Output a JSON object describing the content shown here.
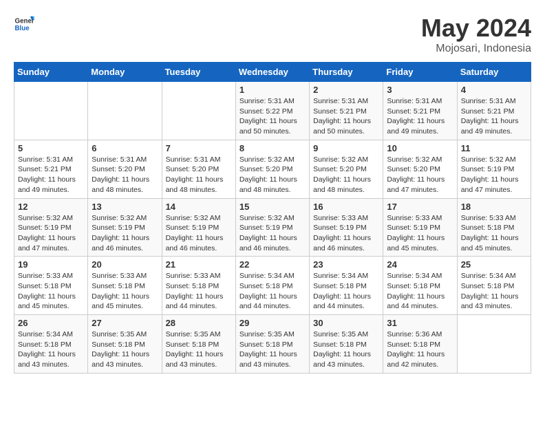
{
  "header": {
    "logo_general": "General",
    "logo_blue": "Blue",
    "month": "May 2024",
    "location": "Mojosari, Indonesia"
  },
  "weekdays": [
    "Sunday",
    "Monday",
    "Tuesday",
    "Wednesday",
    "Thursday",
    "Friday",
    "Saturday"
  ],
  "weeks": [
    [
      {
        "day": "",
        "sunrise": "",
        "sunset": "",
        "daylight": ""
      },
      {
        "day": "",
        "sunrise": "",
        "sunset": "",
        "daylight": ""
      },
      {
        "day": "",
        "sunrise": "",
        "sunset": "",
        "daylight": ""
      },
      {
        "day": "1",
        "sunrise": "Sunrise: 5:31 AM",
        "sunset": "Sunset: 5:22 PM",
        "daylight": "Daylight: 11 hours and 50 minutes."
      },
      {
        "day": "2",
        "sunrise": "Sunrise: 5:31 AM",
        "sunset": "Sunset: 5:21 PM",
        "daylight": "Daylight: 11 hours and 50 minutes."
      },
      {
        "day": "3",
        "sunrise": "Sunrise: 5:31 AM",
        "sunset": "Sunset: 5:21 PM",
        "daylight": "Daylight: 11 hours and 49 minutes."
      },
      {
        "day": "4",
        "sunrise": "Sunrise: 5:31 AM",
        "sunset": "Sunset: 5:21 PM",
        "daylight": "Daylight: 11 hours and 49 minutes."
      }
    ],
    [
      {
        "day": "5",
        "sunrise": "Sunrise: 5:31 AM",
        "sunset": "Sunset: 5:21 PM",
        "daylight": "Daylight: 11 hours and 49 minutes."
      },
      {
        "day": "6",
        "sunrise": "Sunrise: 5:31 AM",
        "sunset": "Sunset: 5:20 PM",
        "daylight": "Daylight: 11 hours and 48 minutes."
      },
      {
        "day": "7",
        "sunrise": "Sunrise: 5:31 AM",
        "sunset": "Sunset: 5:20 PM",
        "daylight": "Daylight: 11 hours and 48 minutes."
      },
      {
        "day": "8",
        "sunrise": "Sunrise: 5:32 AM",
        "sunset": "Sunset: 5:20 PM",
        "daylight": "Daylight: 11 hours and 48 minutes."
      },
      {
        "day": "9",
        "sunrise": "Sunrise: 5:32 AM",
        "sunset": "Sunset: 5:20 PM",
        "daylight": "Daylight: 11 hours and 48 minutes."
      },
      {
        "day": "10",
        "sunrise": "Sunrise: 5:32 AM",
        "sunset": "Sunset: 5:20 PM",
        "daylight": "Daylight: 11 hours and 47 minutes."
      },
      {
        "day": "11",
        "sunrise": "Sunrise: 5:32 AM",
        "sunset": "Sunset: 5:19 PM",
        "daylight": "Daylight: 11 hours and 47 minutes."
      }
    ],
    [
      {
        "day": "12",
        "sunrise": "Sunrise: 5:32 AM",
        "sunset": "Sunset: 5:19 PM",
        "daylight": "Daylight: 11 hours and 47 minutes."
      },
      {
        "day": "13",
        "sunrise": "Sunrise: 5:32 AM",
        "sunset": "Sunset: 5:19 PM",
        "daylight": "Daylight: 11 hours and 46 minutes."
      },
      {
        "day": "14",
        "sunrise": "Sunrise: 5:32 AM",
        "sunset": "Sunset: 5:19 PM",
        "daylight": "Daylight: 11 hours and 46 minutes."
      },
      {
        "day": "15",
        "sunrise": "Sunrise: 5:32 AM",
        "sunset": "Sunset: 5:19 PM",
        "daylight": "Daylight: 11 hours and 46 minutes."
      },
      {
        "day": "16",
        "sunrise": "Sunrise: 5:33 AM",
        "sunset": "Sunset: 5:19 PM",
        "daylight": "Daylight: 11 hours and 46 minutes."
      },
      {
        "day": "17",
        "sunrise": "Sunrise: 5:33 AM",
        "sunset": "Sunset: 5:19 PM",
        "daylight": "Daylight: 11 hours and 45 minutes."
      },
      {
        "day": "18",
        "sunrise": "Sunrise: 5:33 AM",
        "sunset": "Sunset: 5:18 PM",
        "daylight": "Daylight: 11 hours and 45 minutes."
      }
    ],
    [
      {
        "day": "19",
        "sunrise": "Sunrise: 5:33 AM",
        "sunset": "Sunset: 5:18 PM",
        "daylight": "Daylight: 11 hours and 45 minutes."
      },
      {
        "day": "20",
        "sunrise": "Sunrise: 5:33 AM",
        "sunset": "Sunset: 5:18 PM",
        "daylight": "Daylight: 11 hours and 45 minutes."
      },
      {
        "day": "21",
        "sunrise": "Sunrise: 5:33 AM",
        "sunset": "Sunset: 5:18 PM",
        "daylight": "Daylight: 11 hours and 44 minutes."
      },
      {
        "day": "22",
        "sunrise": "Sunrise: 5:34 AM",
        "sunset": "Sunset: 5:18 PM",
        "daylight": "Daylight: 11 hours and 44 minutes."
      },
      {
        "day": "23",
        "sunrise": "Sunrise: 5:34 AM",
        "sunset": "Sunset: 5:18 PM",
        "daylight": "Daylight: 11 hours and 44 minutes."
      },
      {
        "day": "24",
        "sunrise": "Sunrise: 5:34 AM",
        "sunset": "Sunset: 5:18 PM",
        "daylight": "Daylight: 11 hours and 44 minutes."
      },
      {
        "day": "25",
        "sunrise": "Sunrise: 5:34 AM",
        "sunset": "Sunset: 5:18 PM",
        "daylight": "Daylight: 11 hours and 43 minutes."
      }
    ],
    [
      {
        "day": "26",
        "sunrise": "Sunrise: 5:34 AM",
        "sunset": "Sunset: 5:18 PM",
        "daylight": "Daylight: 11 hours and 43 minutes."
      },
      {
        "day": "27",
        "sunrise": "Sunrise: 5:35 AM",
        "sunset": "Sunset: 5:18 PM",
        "daylight": "Daylight: 11 hours and 43 minutes."
      },
      {
        "day": "28",
        "sunrise": "Sunrise: 5:35 AM",
        "sunset": "Sunset: 5:18 PM",
        "daylight": "Daylight: 11 hours and 43 minutes."
      },
      {
        "day": "29",
        "sunrise": "Sunrise: 5:35 AM",
        "sunset": "Sunset: 5:18 PM",
        "daylight": "Daylight: 11 hours and 43 minutes."
      },
      {
        "day": "30",
        "sunrise": "Sunrise: 5:35 AM",
        "sunset": "Sunset: 5:18 PM",
        "daylight": "Daylight: 11 hours and 43 minutes."
      },
      {
        "day": "31",
        "sunrise": "Sunrise: 5:36 AM",
        "sunset": "Sunset: 5:18 PM",
        "daylight": "Daylight: 11 hours and 42 minutes."
      },
      {
        "day": "",
        "sunrise": "",
        "sunset": "",
        "daylight": ""
      }
    ]
  ]
}
